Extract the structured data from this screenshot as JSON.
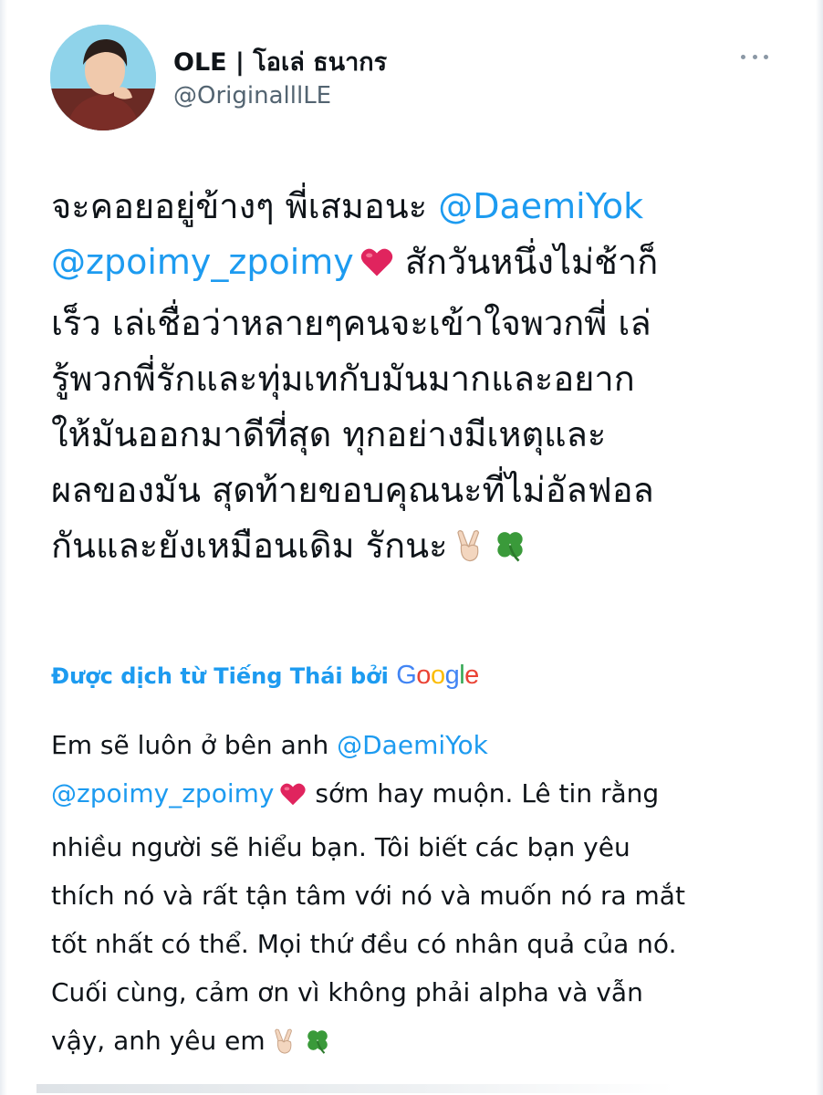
{
  "tweet": {
    "author": {
      "display_name": "OLE | โอเล่ ธนากร",
      "handle": "@OriginalllLE"
    },
    "text_lines": [
      {
        "pre": "จะคอยอยู่ข้างๆ พี่เสมอนะ ",
        "mention": "@DaemiYok",
        "post": "",
        "emoji": ""
      },
      {
        "pre": "",
        "mention": "@zpoimy_zpoimy",
        "post": " สักวันหนึ่งไม่ช้าก็",
        "emoji": "red-heart"
      },
      {
        "pre": "เร็ว เล่เชื่อว่าหลายๆคนจะเข้าใจพวกพี่ เล่",
        "mention": "",
        "post": "",
        "emoji": ""
      },
      {
        "pre": "รู้พวกพี่รักและทุ่มเทกับมันมากและอยาก",
        "mention": "",
        "post": "",
        "emoji": ""
      },
      {
        "pre": "ให้มันออกมาดีที่สุด ทุกอย่างมีเหตุและ",
        "mention": "",
        "post": "",
        "emoji": ""
      },
      {
        "pre": "ผลของมัน สุดท้ายขอบคุณนะที่ไม่อัลฟอล",
        "mention": "",
        "post": "",
        "emoji": ""
      },
      {
        "pre": "กันและยังเหมือนเดิม รักนะ",
        "mention": "",
        "post": "",
        "emoji": "victory-and-clover"
      }
    ],
    "translation": {
      "label": "Được dịch từ Tiếng Thái bởi ",
      "provider_letters": [
        "G",
        "o",
        "o",
        "g",
        "l",
        "e"
      ],
      "provider_colors": [
        "#4285f4",
        "#ea4335",
        "#fbbc05",
        "#4285f4",
        "#34a853",
        "#ea4335"
      ],
      "text_lines": [
        {
          "pre": "Em sẽ luôn ở bên anh ",
          "mention": "@DaemiYok",
          "post": "",
          "emoji": ""
        },
        {
          "pre": "",
          "mention": "@zpoimy_zpoimy",
          "post": " sớm hay muộn. Lê tin rằng",
          "emoji": "red-heart"
        },
        {
          "pre": "nhiều người sẽ hiểu bạn. Tôi biết các bạn yêu",
          "mention": "",
          "post": "",
          "emoji": ""
        },
        {
          "pre": "thích nó và rất tận tâm với nó và muốn nó ra mắt",
          "mention": "",
          "post": "",
          "emoji": ""
        },
        {
          "pre": "tốt nhất có thể. Mọi thứ đều có nhân quả của nó.",
          "mention": "",
          "post": "",
          "emoji": ""
        },
        {
          "pre": "Cuối cùng, cảm ơn vì không phải alpha và vẫn",
          "mention": "",
          "post": "",
          "emoji": ""
        },
        {
          "pre": "vậy, anh yêu em",
          "mention": "",
          "post": "",
          "emoji": "victory-and-clover"
        }
      ]
    }
  },
  "colors": {
    "text": "#0f1419",
    "secondary": "#536471",
    "accent": "#1d9bf0",
    "heart": "#e0245e",
    "clover": "#3a9a3a"
  },
  "icons": {
    "more": "more-options-icon",
    "heart": "red-heart-icon",
    "victory": "victory-hand-icon",
    "clover": "four-leaf-clover-icon"
  }
}
